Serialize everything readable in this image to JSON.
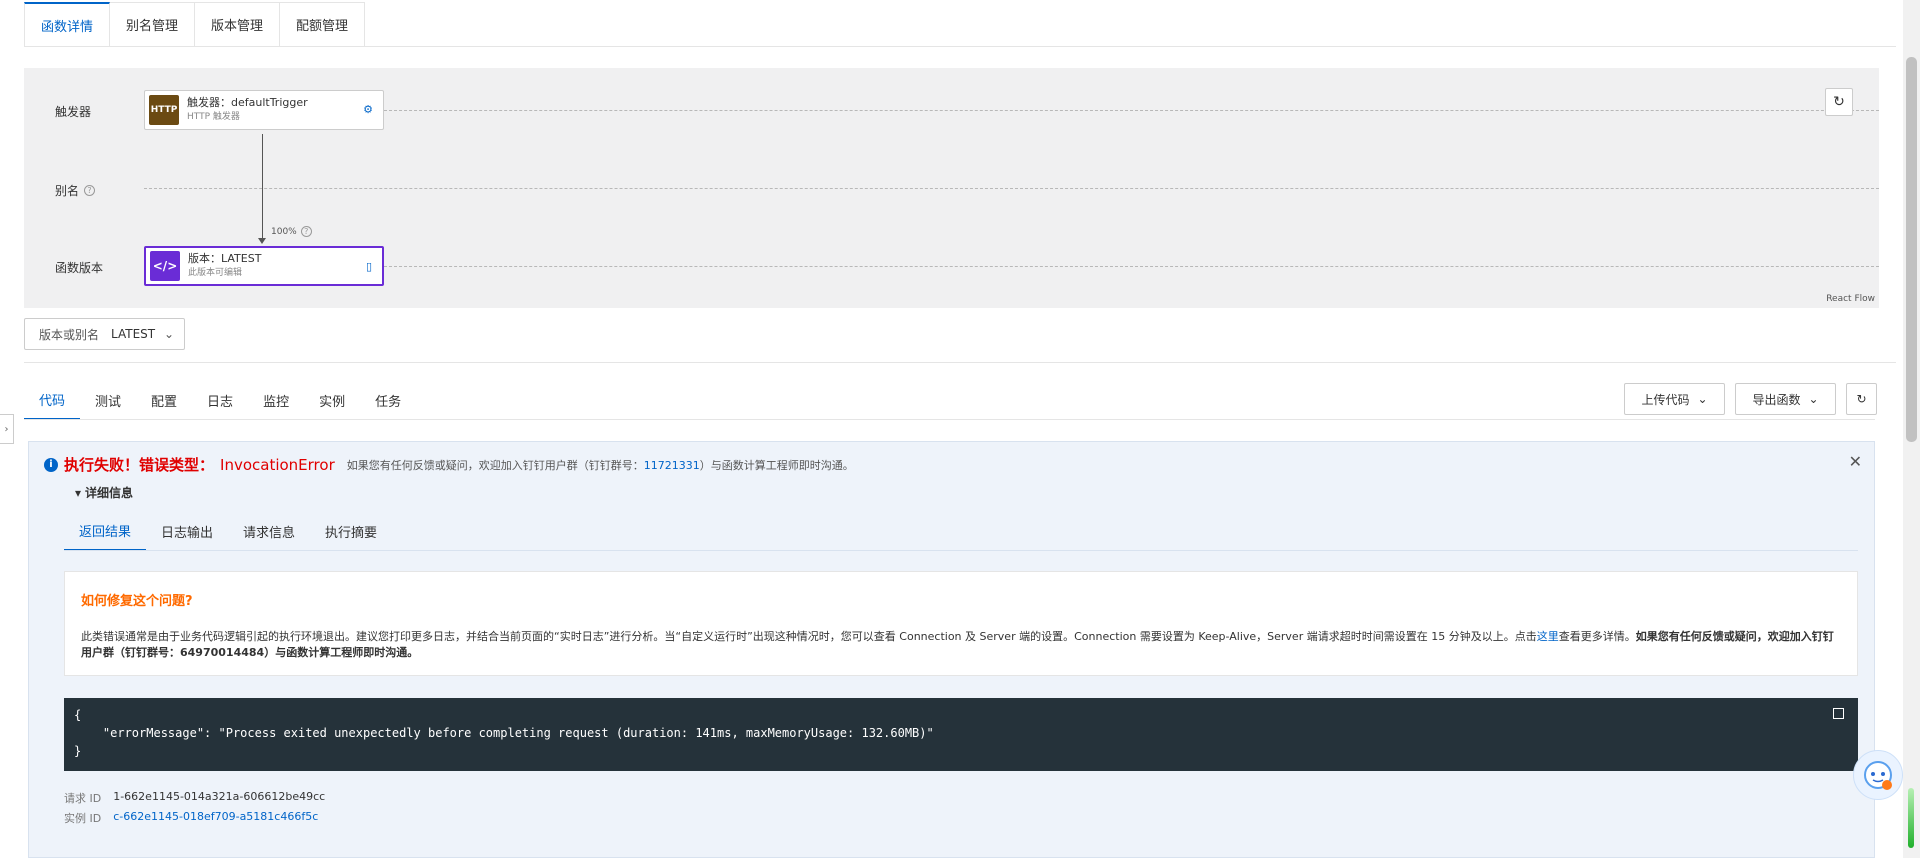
{
  "top_tabs": [
    "函数详情",
    "别名管理",
    "版本管理",
    "配额管理"
  ],
  "flow": {
    "rows": {
      "trigger": "触发器",
      "alias": "别名",
      "version": "函数版本"
    },
    "trigger_node": {
      "icon_text": "HTTP",
      "title": "触发器：defaultTrigger",
      "subtitle": "HTTP 触发器",
      "icon_color": "#6b4a12"
    },
    "version_node": {
      "title": "版本：LATEST",
      "subtitle": "此版本可编辑",
      "icon_color": "#6a2cd6"
    },
    "traffic_label": "100%",
    "watermark": "React Flow"
  },
  "version_select": {
    "label": "版本或别名",
    "value": "LATEST"
  },
  "code_tabs": [
    "代码",
    "测试",
    "配置",
    "日志",
    "监控",
    "实例",
    "任务"
  ],
  "actions": {
    "upload": "上传代码",
    "export": "导出函数"
  },
  "error": {
    "title": "执行失败！错误类型：",
    "type": "InvocationError",
    "note_prefix": "如果您有任何反馈或疑问，欢迎加入钉钉用户群（钉钉群号：",
    "group_id": "11721331",
    "note_suffix": "）与函数计算工程师即时沟通。",
    "details_label": "详细信息",
    "sub_tabs": [
      "返回结果",
      "日志输出",
      "请求信息",
      "执行摘要"
    ],
    "fix_title": "如何修复这个问题?",
    "fix_text_1": "此类错误通常是由于业务代码逻辑引起的执行环境退出。建议您打印更多日志，并结合当前页面的“实时日志”进行分析。当“自定义运行时”出现这种情况时，您可以查看 Connection 及 Server 端的设置。Connection 需要设置为 Keep-Alive，Server 端请求超时时间需设置在 15 分钟及以上。点击",
    "fix_link": "这里",
    "fix_text_2": "查看更多详情。",
    "fix_bold": "如果您有任何反馈或疑问，欢迎加入钉钉用户群（钉钉群号：64970014484）与函数计算工程师即时沟通。",
    "code_lines": [
      "{",
      "    \"errorMessage\": \"Process exited unexpectedly before completing request (duration: 141ms, maxMemoryUsage: 132.60MB)\"",
      "}"
    ],
    "request_id_label": "请求 ID",
    "request_id": "1-662e1145-014a321a-606612be49cc",
    "instance_id_label": "实例 ID",
    "instance_id": "c-662e1145-018ef709-a5181c466f5c"
  }
}
